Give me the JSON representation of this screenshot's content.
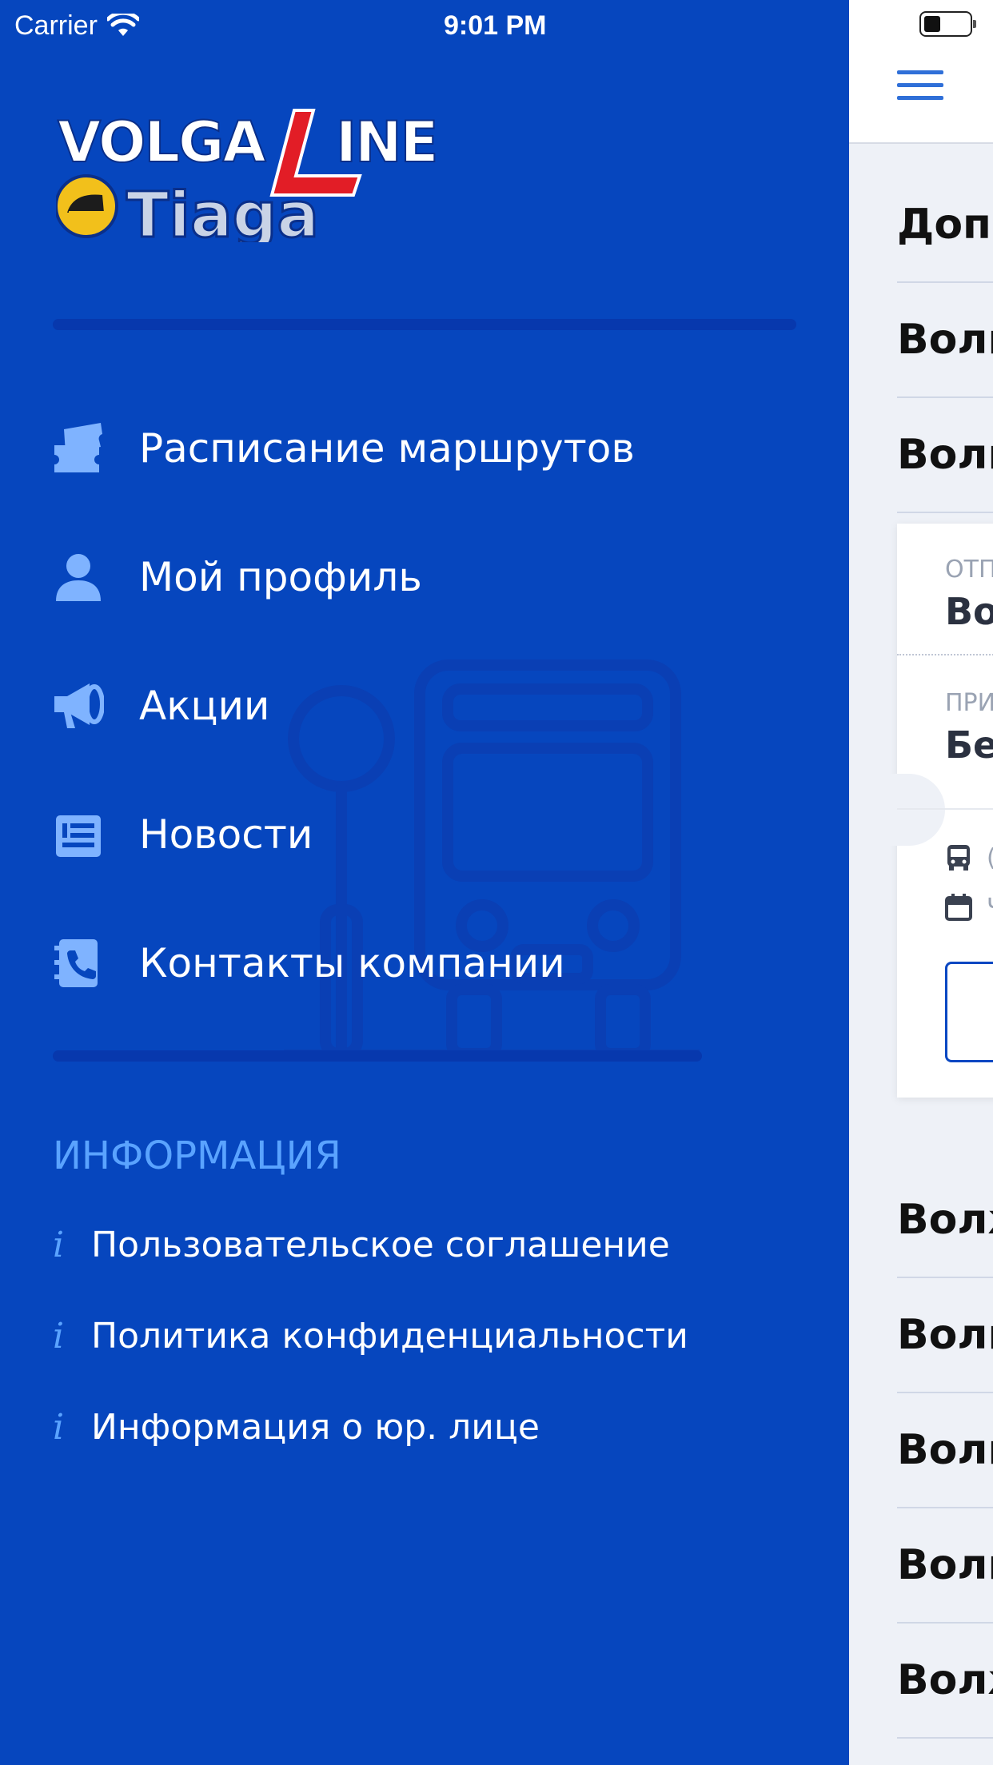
{
  "status_bar": {
    "carrier": "Carrier",
    "time": "9:01 PM",
    "wifi_icon": "wifi-icon",
    "battery_icon": "battery-icon"
  },
  "logo": {
    "brand_top": "VOLGALINE",
    "brand_bottom": "Tiaga"
  },
  "menu": [
    {
      "label": "Расписание маршрутов",
      "icon": "ticket-icon"
    },
    {
      "label": "Мой профиль",
      "icon": "user-icon"
    },
    {
      "label": "Акции",
      "icon": "megaphone-icon"
    },
    {
      "label": "Новости",
      "icon": "newspaper-icon"
    },
    {
      "label": "Контакты компании",
      "icon": "phone-book-icon"
    }
  ],
  "info": {
    "title": "ИНФОРМАЦИЯ",
    "items": [
      {
        "label": "Пользовательское соглашение",
        "icon": "info-icon"
      },
      {
        "label": "Политика конфиденциальности",
        "icon": "info-icon"
      },
      {
        "label": "Информация о юр. лице",
        "icon": "info-icon"
      }
    ]
  },
  "main_peek": {
    "routes_top": [
      "Допо",
      "Волг",
      "Волг"
    ],
    "card": {
      "from_label": "ОТП",
      "from_value": "Во.",
      "to_label": "ПРИ",
      "to_value": "Бе.",
      "transport_text": "(",
      "date_text": "Ч"
    },
    "routes_bottom": [
      "Волж",
      "Волг",
      "Волг",
      "Волг",
      "Волж"
    ]
  },
  "colors": {
    "drawer_bg": "#0646be",
    "accent_light": "#5aa3ff",
    "logo_red": "#e21d26"
  }
}
